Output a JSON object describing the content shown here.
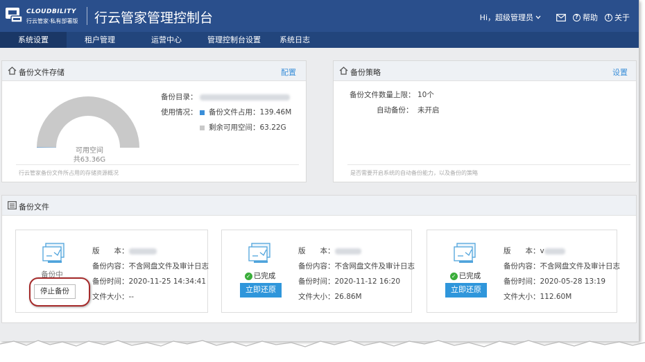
{
  "header": {
    "logo_en": "CLOUDBILITY",
    "logo_cn": "行云管家·私有部署版",
    "app_title": "行云管家管理控制台",
    "greeting": "Hi，超级管理员",
    "help": "帮助",
    "about": "关于"
  },
  "nav": {
    "items": [
      "系统设置",
      "租户管理",
      "运营中心",
      "管理控制台设置",
      "系统日志"
    ],
    "active": "系统设置"
  },
  "storage_panel": {
    "title": "备份文件存储",
    "config_link": "配置",
    "gauge_label": "可用空间",
    "gauge_total": "共63.36G",
    "dir_label": "备份目录：",
    "usage_label": "使用情况：",
    "used_legend": "备份文件占用：139.46M",
    "free_legend": "剩余可用空间：63.22G",
    "used_color": "#3b8fd9",
    "free_color": "#c9c9c9",
    "used_fraction": 0.0021,
    "hint": "行云管家备份文件所占用的存储资源概况"
  },
  "policy_panel": {
    "title": "备份策略",
    "settings_link": "设置",
    "max_label": "备份文件数量上限：",
    "max_value": "10个",
    "auto_label": "自动备份：",
    "auto_value": "未开启",
    "hint": "是否需要开启系统的自动备份能力，以及备份的策略"
  },
  "files_panel": {
    "title": "备份文件",
    "cards": [
      {
        "status": "备份中",
        "action": "停止备份",
        "version_label": "版　　本：",
        "content": "备份内容：不含网盘文件及审计日志",
        "time": "备份时间：2020-11-25 14:34:41",
        "size": "文件大小：--"
      },
      {
        "status": "已完成",
        "action": "立即还原",
        "version_label": "版　　本：",
        "content": "备份内容：不含网盘文件及审计日志",
        "time": "备份时间：2020-11-12 16:20",
        "size": "文件大小：26.86M"
      },
      {
        "status": "已完成",
        "action": "立即还原",
        "version_label": "版　　本：",
        "version_prefix": "v",
        "content": "备份内容：不含网盘文件及审计日志",
        "time": "备份时间：2020-05-28 13:19",
        "size": "文件大小：112.60M"
      }
    ]
  },
  "icons": [
    "logo-icon",
    "chevron-down-icon",
    "mail-icon",
    "help-icon",
    "info-icon",
    "home-icon",
    "list-icon",
    "backup-file-icon",
    "check-circle-icon"
  ],
  "colors": {
    "header": "#2a4f8c",
    "nav": "#22457c",
    "accent": "#2f96db",
    "highlight": "#a52a2a",
    "success": "#3aad3a"
  }
}
